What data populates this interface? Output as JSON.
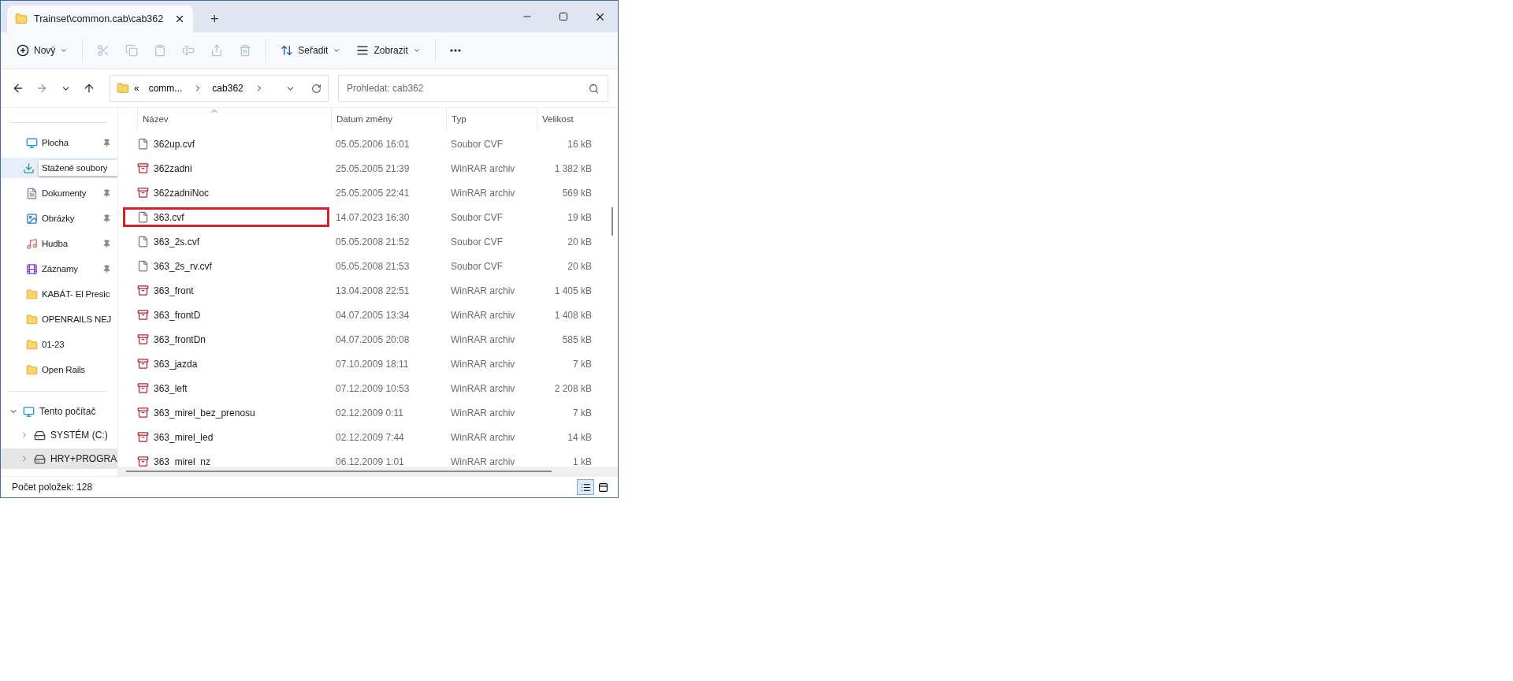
{
  "window": {
    "tab_title": "Trainset\\common.cab\\cab362",
    "new_tab": "+"
  },
  "toolbar": {
    "new_label": "Nový",
    "sort_label": "Seřadit",
    "view_label": "Zobrazit"
  },
  "address": {
    "overflow": "«",
    "crumbs": [
      "comm...",
      "cab362"
    ]
  },
  "search": {
    "placeholder": "Prohledat: cab362"
  },
  "sidebar": {
    "quick": [
      {
        "label": "Plocha",
        "kind": "desktop",
        "pinned": true,
        "selected": false
      },
      {
        "label": "Stažené soubory",
        "kind": "download",
        "pinned": false,
        "selected": true
      },
      {
        "label": "Dokumenty",
        "kind": "documents",
        "pinned": true,
        "selected": false
      },
      {
        "label": "Obrázky",
        "kind": "pictures",
        "pinned": true,
        "selected": false
      },
      {
        "label": "Hudba",
        "kind": "music",
        "pinned": true,
        "selected": false
      },
      {
        "label": "Záznamy",
        "kind": "videos",
        "pinned": true,
        "selected": false
      },
      {
        "label": "KABÁT- El Presic",
        "kind": "folder",
        "pinned": false,
        "selected": false
      },
      {
        "label": "OPENRAILS NEJ",
        "kind": "folder",
        "pinned": false,
        "selected": false
      },
      {
        "label": "01-23",
        "kind": "folder",
        "pinned": false,
        "selected": false
      },
      {
        "label": "Open Rails",
        "kind": "folder",
        "pinned": false,
        "selected": false
      }
    ],
    "tree": [
      {
        "label": "Tento počítač",
        "kind": "computer",
        "expanded": true,
        "selected": false,
        "children": [
          {
            "label": "SYSTÉM (C:)",
            "kind": "drive",
            "expanded": false,
            "selected": false
          },
          {
            "label": "HRY+PROGRA",
            "kind": "drive",
            "expanded": false,
            "selected": true
          }
        ]
      }
    ]
  },
  "table": {
    "columns": [
      "Název",
      "Datum změny",
      "Typ",
      "Velikost"
    ],
    "rows": [
      {
        "name": "362up.cvf",
        "date": "05.05.2006 16:01",
        "type": "Soubor CVF",
        "size": "16 kB",
        "kind": "document",
        "marked": false
      },
      {
        "name": "362zadni",
        "date": "25.05.2005 21:39",
        "type": "WinRAR archiv",
        "size": "1 382 kB",
        "kind": "archive",
        "marked": false
      },
      {
        "name": "362zadniNoc",
        "date": "25.05.2005 22:41",
        "type": "WinRAR archiv",
        "size": "569 kB",
        "kind": "archive",
        "marked": false
      },
      {
        "name": "363.cvf",
        "date": "14.07.2023 16:30",
        "type": "Soubor CVF",
        "size": "19 kB",
        "kind": "document",
        "marked": true
      },
      {
        "name": "363_2s.cvf",
        "date": "05.05.2008 21:52",
        "type": "Soubor CVF",
        "size": "20 kB",
        "kind": "document",
        "marked": false
      },
      {
        "name": "363_2s_rv.cvf",
        "date": "05.05.2008 21:53",
        "type": "Soubor CVF",
        "size": "20 kB",
        "kind": "document",
        "marked": false
      },
      {
        "name": "363_front",
        "date": "13.04.2008 22:51",
        "type": "WinRAR archiv",
        "size": "1 405 kB",
        "kind": "archive",
        "marked": false
      },
      {
        "name": "363_frontD",
        "date": "04.07.2005 13:34",
        "type": "WinRAR archiv",
        "size": "1 408 kB",
        "kind": "archive",
        "marked": false
      },
      {
        "name": "363_frontDn",
        "date": "04.07.2005 20:08",
        "type": "WinRAR archiv",
        "size": "585 kB",
        "kind": "archive",
        "marked": false
      },
      {
        "name": "363_jazda",
        "date": "07.10.2009 18:11",
        "type": "WinRAR archiv",
        "size": "7 kB",
        "kind": "archive",
        "marked": false
      },
      {
        "name": "363_left",
        "date": "07.12.2009 10:53",
        "type": "WinRAR archiv",
        "size": "2 208 kB",
        "kind": "archive",
        "marked": false
      },
      {
        "name": "363_mirel_bez_prenosu",
        "date": "02.12.2009 0:11",
        "type": "WinRAR archiv",
        "size": "7 kB",
        "kind": "archive",
        "marked": false
      },
      {
        "name": "363_mirel_led",
        "date": "02.12.2009 7:44",
        "type": "WinRAR archiv",
        "size": "14 kB",
        "kind": "archive",
        "marked": false
      },
      {
        "name": "363_mirel_nz",
        "date": "06.12.2009 1:01",
        "type": "WinRAR archiv",
        "size": "1 kB",
        "kind": "archive",
        "marked": false
      }
    ]
  },
  "status_bar": {
    "count": "Počet položek: 128",
    "view_buttons": [
      {
        "kind": "details",
        "selected": true
      },
      {
        "kind": "tiles",
        "selected": false
      }
    ]
  }
}
